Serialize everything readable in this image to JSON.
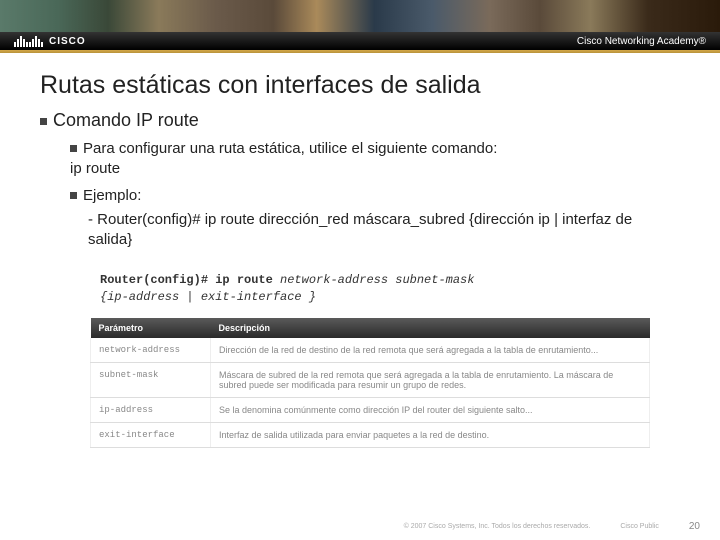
{
  "header": {
    "logo_text": "CISCO",
    "academy": "Cisco Networking Academy®"
  },
  "title": "Rutas estáticas con interfaces de salida",
  "subtitle": "Comando IP route",
  "bullets": {
    "config_intro": "Para configurar una ruta estática, utilice el siguiente comando:",
    "config_cmd": "ip route",
    "example_label": "Ejemplo:",
    "example_text": "- Router(config)# ip route dirección_red máscara_subred {dirección ip | interfaz de salida}"
  },
  "code_block": {
    "prompt": "Router(config)# ip route ",
    "args": "network-address  subnet-mask",
    "line2": "{ip-address | exit-interface }"
  },
  "table": {
    "headers": [
      "Parámetro",
      "Descripción"
    ],
    "rows": [
      [
        "network-address",
        "Dirección de la red de destino de la red remota que será agregada a la tabla de enrutamiento..."
      ],
      [
        "subnet-mask",
        "Máscara de subred de la red remota que será agregada a la tabla de enrutamiento.  La máscara de subred puede ser modificada para resumir un grupo de redes."
      ],
      [
        "ip-address",
        "Se la denomina comúnmente como dirección IP del router del siguiente salto..."
      ],
      [
        "exit-interface",
        "Interfaz de salida utilizada para enviar paquetes a la red de destino."
      ]
    ]
  },
  "footer": {
    "copyright": "© 2007 Cisco Systems, Inc. Todos los derechos reservados.",
    "label": "Cisco Public",
    "page": "20"
  }
}
